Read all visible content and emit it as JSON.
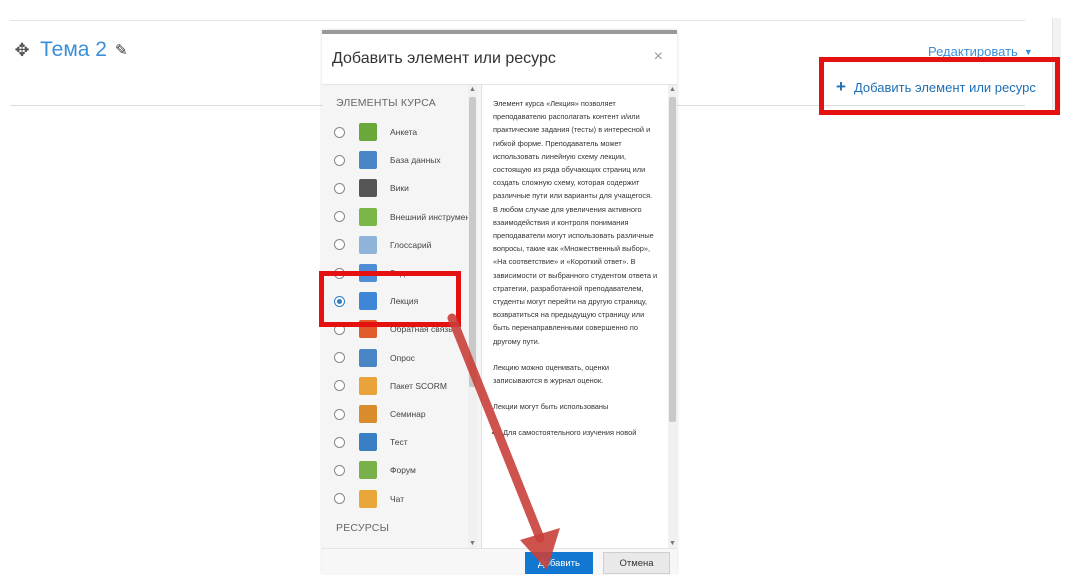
{
  "page": {
    "topic_title": "Тема 2",
    "edit_menu_label": "Редактировать",
    "add_activity_label": "Добавить элемент или ресурс",
    "plus_glyph": "+",
    "move_glyph": "✥",
    "pencil_glyph": "✎",
    "caret_glyph": "▼"
  },
  "modal": {
    "title": "Добавить элемент или ресурс",
    "close_glyph": "×",
    "activities_heading": "ЭЛЕМЕНТЫ КУРСА",
    "resources_heading": "РЕСУРСЫ",
    "modules": [
      {
        "label": "Анкета",
        "icon": "survey-icon",
        "color": "#6aa83a",
        "selected": false
      },
      {
        "label": "База данных",
        "icon": "database-icon",
        "color": "#4a86c6",
        "selected": false
      },
      {
        "label": "Вики",
        "icon": "wiki-icon",
        "color": "#555555",
        "selected": false
      },
      {
        "label": "Внешний инструмент",
        "icon": "puzzle-icon",
        "color": "#7ab648",
        "selected": false
      },
      {
        "label": "Глоссарий",
        "icon": "glossary-icon",
        "color": "#8fb3d9",
        "selected": false
      },
      {
        "label": "Задание",
        "icon": "assignment-icon",
        "color": "#4d8ed6",
        "selected": false
      },
      {
        "label": "Лекция",
        "icon": "lesson-icon",
        "color": "#3f86d6",
        "selected": true
      },
      {
        "label": "Обратная связь",
        "icon": "feedback-icon",
        "color": "#e05a2a",
        "selected": false
      },
      {
        "label": "Опрос",
        "icon": "question-icon",
        "color": "#4a86c6",
        "selected": false
      },
      {
        "label": "Пакет SCORM",
        "icon": "scorm-icon",
        "color": "#e8a33a",
        "selected": false
      },
      {
        "label": "Семинар",
        "icon": "workshop-icon",
        "color": "#d98c2b",
        "selected": false
      },
      {
        "label": "Тест",
        "icon": "quiz-icon",
        "color": "#3a7fc4",
        "selected": false
      },
      {
        "label": "Форум",
        "icon": "forum-icon",
        "color": "#78b04a",
        "selected": false
      },
      {
        "label": "Чат",
        "icon": "chat-icon",
        "color": "#e9a63a",
        "selected": false
      }
    ],
    "description": [
      "Элемент курса «Лекция» позволяет преподавателю располагать контент и/или практические задания (тесты) в интересной и гибкой форме. Преподаватель может использовать линейную схему лекции, состоящую из ряда обучающих страниц или создать сложную схему, которая содержит различные пути или варианты для учащегося. В любом случае для увеличения активного взаимодействия и контроля понимания преподаватели могут использовать различные вопросы, такие как «Множественный выбор», «На соответствие» и «Короткий ответ». В зависимости от выбранного студентом ответа и стратегии, разработанной преподавателем, студенты могут перейти на другую страницу, возвратиться на предыдущую страницу или быть перенаправленными совершенно по другому пути.",
      "Лекцию можно оценивать, оценки записываются в журнал оценок.",
      "Лекции могут быть использованы"
    ],
    "description_list_item": "Для самостоятельного изучения новой",
    "add_button": "Добавить",
    "cancel_button": "Отмена"
  },
  "annotations": {
    "highlight_color": "#e51010",
    "arrow_color": "#c9403a"
  }
}
